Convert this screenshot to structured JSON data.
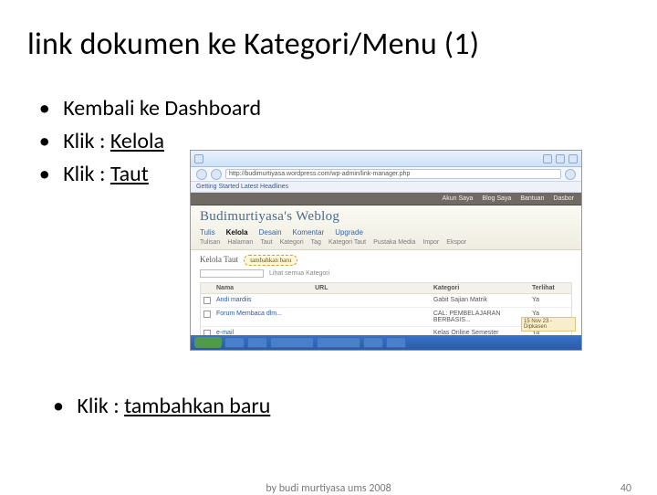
{
  "title": "link dokumen ke Kategori/Menu (1)",
  "bullets": {
    "b1": "Kembali ke Dashboard",
    "b2a": "Klik : ",
    "b2b": "Kelola",
    "b3a": "Klik : ",
    "b3b": "Taut",
    "b4a": "Klik : ",
    "b4b": "tambahkan baru"
  },
  "footer": {
    "center": "by budi murtiyasa ums 2008",
    "page": "40"
  },
  "shot": {
    "url": "http://budimurtiyasa.wordpress.com/wp-admin/link-manager.php",
    "linkbar": "Getting Started   Latest Headlines",
    "tabs": [
      "Akun Saya",
      "Blog Saya",
      "Bantuan",
      "Dasbor"
    ],
    "blog_title": "Budimurtiyasa's Weblog",
    "nav": [
      "Tulis",
      "Kelola",
      "Desain",
      "Komentar",
      "Upgrade"
    ],
    "subnav": [
      "Tulisan",
      "Halaman",
      "Taut",
      "Kategori",
      "Tag",
      "Kategori Taut",
      "Pustaka Media",
      "Impor",
      "Ekspor"
    ],
    "section_label": "Kelola Taut",
    "addnew": "tambahkan baru",
    "filters": "Lihat semua Kategori",
    "th": {
      "name": "Nama",
      "url": "URL",
      "kategori": "Kategori",
      "terlihat": "Terlihat"
    },
    "rows": [
      {
        "name": "Andi mardiis",
        "url": "",
        "kategori": "Gabit Sajian Matrik",
        "vis": "Ya"
      },
      {
        "name": "Forum Membaca dlm...",
        "url": "",
        "kategori": "CAL: PEMBELAJARAN BERBASIS...",
        "vis": "Ya"
      },
      {
        "name": "e-mail",
        "url": "",
        "kategori": "Kelas Online Semester",
        "vis": "Ya"
      }
    ],
    "corner": "15 Nov 23 - Dipkasen"
  }
}
